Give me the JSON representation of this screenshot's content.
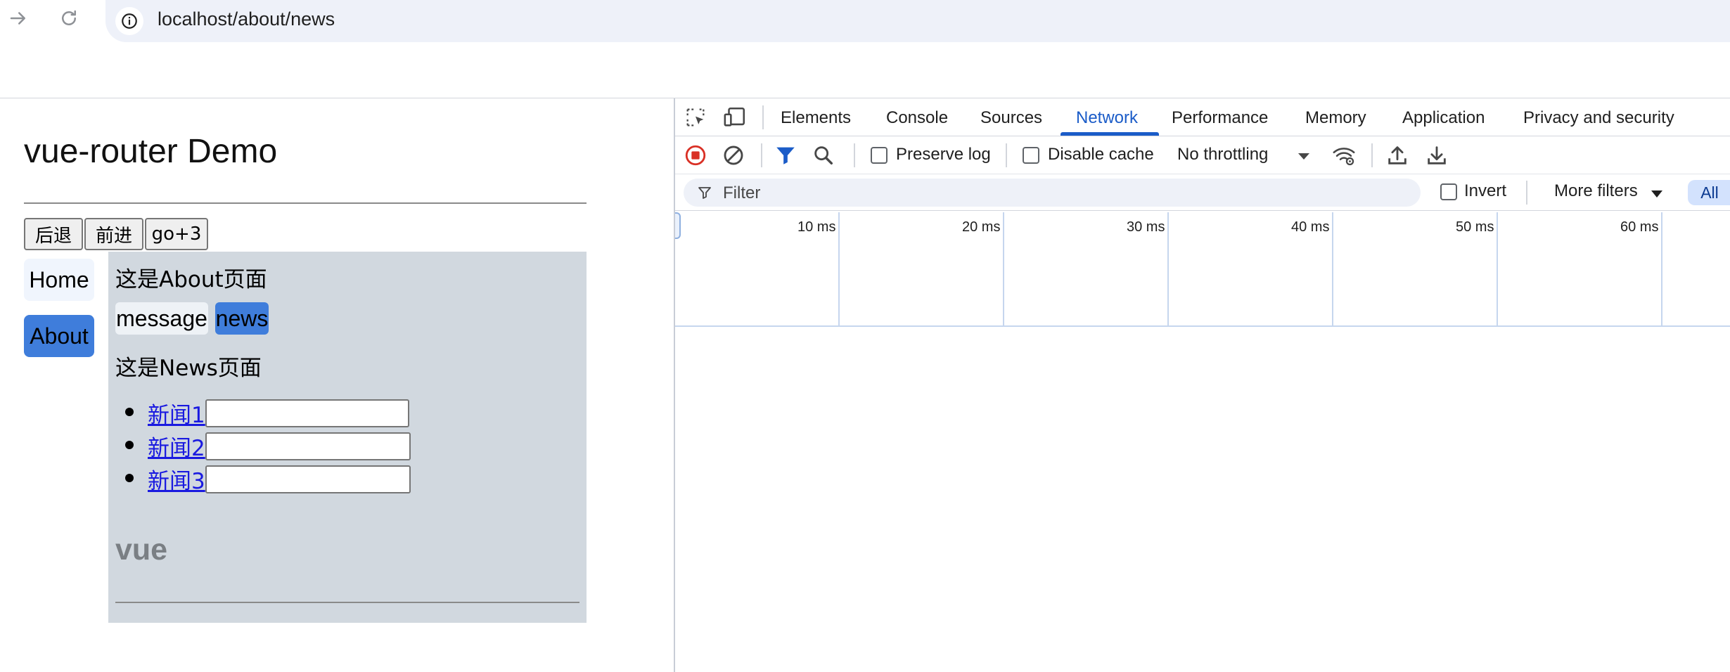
{
  "browser": {
    "url": "localhost/about/news",
    "icons": [
      "forward-arrow-icon",
      "reload-icon",
      "info-icon"
    ]
  },
  "page": {
    "title": "vue-router Demo",
    "buttons": {
      "back": "后退",
      "forward": "前进",
      "go3": "go+3"
    },
    "sidebar": {
      "home": "Home",
      "about": "About"
    },
    "about_heading": "这是About页面",
    "subtabs": {
      "message": "message",
      "news": "news"
    },
    "news_heading": "这是News页面",
    "news_items": [
      {
        "label": "新闻1",
        "value": ""
      },
      {
        "label": "新闻2",
        "value": ""
      },
      {
        "label": "新闻3",
        "value": ""
      }
    ],
    "footer_text": "vue",
    "colors": {
      "active_link_bg": "#3f7ddb",
      "panel_bg": "#d1d8df"
    }
  },
  "devtools": {
    "tabs": [
      "Elements",
      "Console",
      "Sources",
      "Network",
      "Performance",
      "Memory",
      "Application",
      "Privacy and security"
    ],
    "active_tab": "Network",
    "toolbar": {
      "preserve_log": "Preserve log",
      "preserve_log_checked": false,
      "disable_cache": "Disable cache",
      "disable_cache_checked": false,
      "throttling": "No throttling"
    },
    "filter": {
      "placeholder": "Filter",
      "invert": "Invert",
      "invert_checked": false,
      "more_filters": "More filters",
      "all": "All"
    },
    "timeline_ticks": [
      "10 ms",
      "20 ms",
      "30 ms",
      "40 ms",
      "50 ms",
      "60 ms"
    ],
    "accent_color": "#1b5cc8"
  }
}
